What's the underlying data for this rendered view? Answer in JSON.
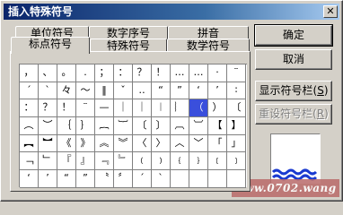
{
  "window": {
    "title": "插入特殊符号",
    "close_glyph": "✕"
  },
  "tabs_back": [
    "单位符号",
    "数字序号",
    "拼音"
  ],
  "tabs_front": [
    "标点符号",
    "特殊符号",
    "数学符号"
  ],
  "active_tab": "标点符号",
  "symbols": [
    [
      "，",
      "、",
      "。",
      ".",
      "；",
      "：",
      "？",
      "！",
      "…",
      "…",
      "·",
      "¨"
    ],
    [
      "ˊ",
      "ˋ",
      "々",
      "～",
      "‖",
      "ˇ",
      "‥",
      "“",
      "”",
      "‘",
      "’",
      "∶"
    ],
    [
      "：",
      "？",
      "！",
      "¨",
      "—",
      "｜",
      "｜",
      "︱",
      "︴",
      "（",
      "）",
      "〔"
    ],
    [
      "︵",
      "︶",
      "｛",
      "｝",
      "︷",
      "︸",
      "〔",
      "〕",
      "︹",
      "︺",
      "【",
      "】"
    ],
    [
      "︻",
      "︼",
      "《",
      "》",
      "︽",
      "︾",
      "〈",
      "〉",
      "︿",
      "﹀",
      "「",
      "」"
    ],
    [
      "﹁",
      "﹂",
      "『",
      "』",
      "﹃",
      "﹄",
      "﹙",
      "﹚",
      "﹛",
      "﹜",
      "﹝",
      "﹞"
    ],
    [
      "‘",
      "’",
      "“",
      "”",
      "〝",
      "〞",
      "ˊ",
      "ˋ",
      "",
      "",
      "",
      ""
    ]
  ],
  "selected_cell": {
    "row": 2,
    "col": 9
  },
  "buttons": {
    "ok": "确定",
    "cancel": "取消",
    "show_bar": "显示符号栏",
    "show_bar_key": "S",
    "reset_bar": "重设符号栏",
    "reset_bar_key": "R"
  },
  "watermark": "www.0702.wang"
}
